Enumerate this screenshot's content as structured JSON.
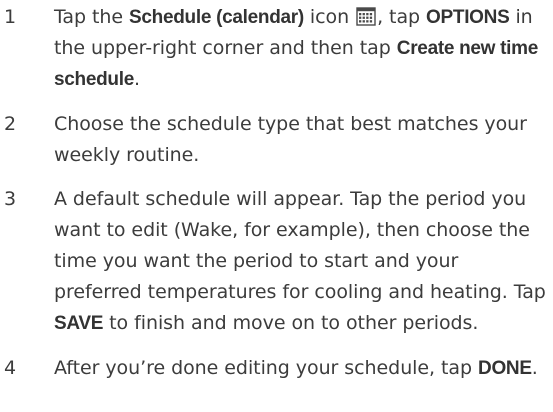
{
  "steps": [
    {
      "number": "1",
      "t1": "Tap the ",
      "b1": "Schedule (calendar)",
      "t2": " icon ",
      "icon": "calendar-icon",
      "t3": ", tap ",
      "b2": "OPTIONS",
      "t4": " in the upper-right corner and then tap ",
      "b3": "Create new time schedule",
      "t5": "."
    },
    {
      "number": "2",
      "t1": "Choose the schedule type that best matches your weekly routine."
    },
    {
      "number": "3",
      "t1": "A default schedule will appear. Tap the period you want to edit (Wake, for example), then choose the time you want the period to start and your preferred temperatures for cooling and heating. Tap ",
      "b1": "SAVE",
      "t2": " to finish and move on to other periods."
    },
    {
      "number": "4",
      "t1": "After you’re done editing your schedule, tap ",
      "b1": "DONE",
      "t2": "."
    }
  ]
}
